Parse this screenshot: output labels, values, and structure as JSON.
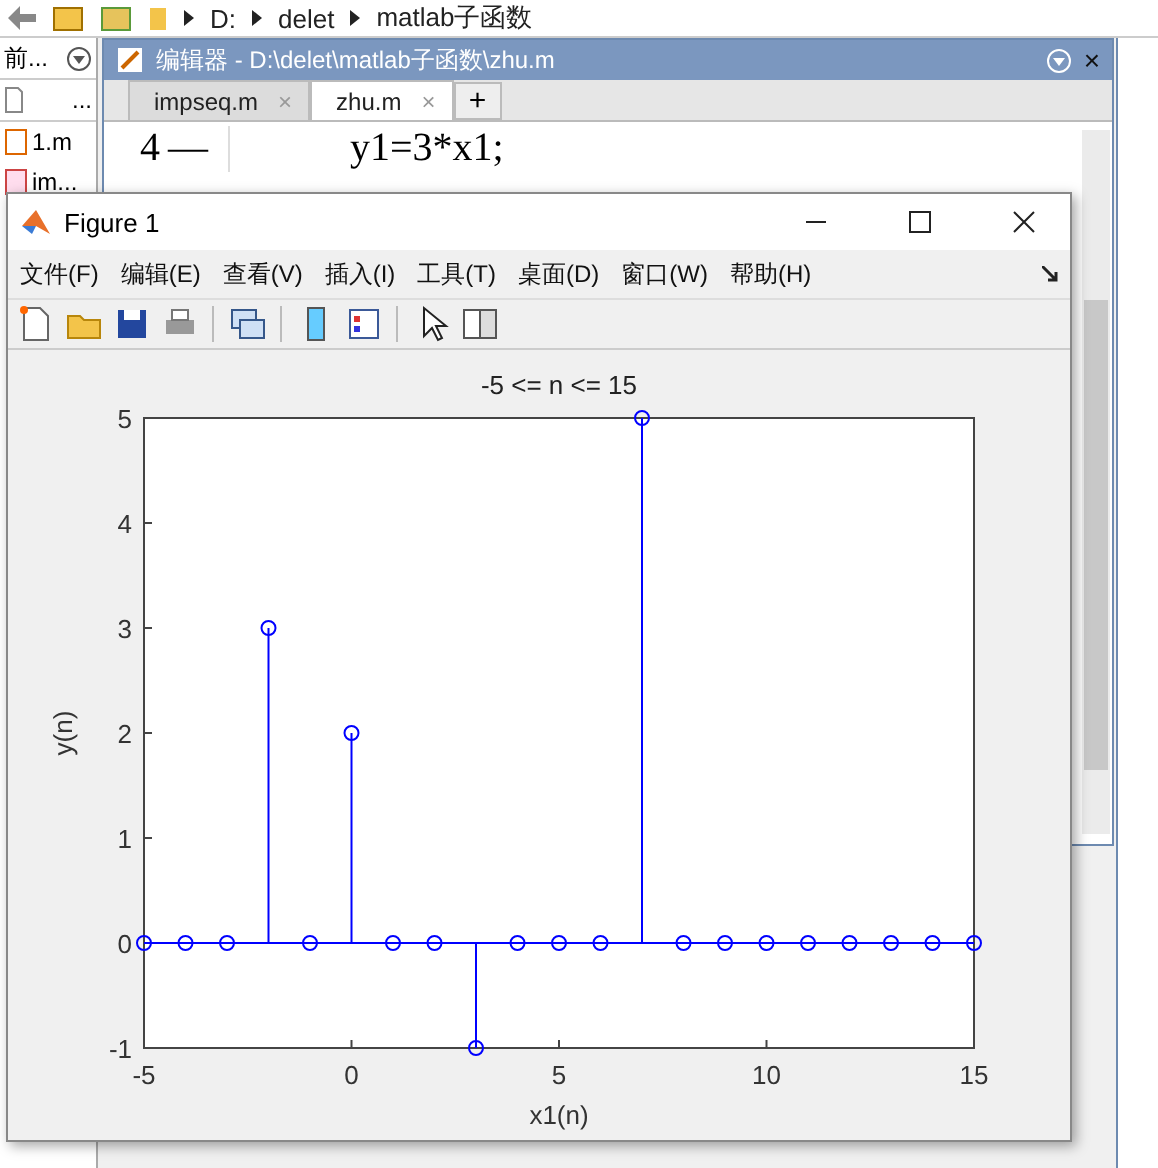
{
  "address_bar": {
    "segments": [
      "D:",
      "delet",
      "matlab子函数"
    ]
  },
  "file_panel": {
    "header": "前...",
    "column": "...",
    "files": [
      {
        "name": "1.m",
        "kind": "script"
      },
      {
        "name": "im...",
        "kind": "function"
      }
    ]
  },
  "editor": {
    "title": "编辑器 - D:\\delet\\matlab子函数\\zhu.m",
    "close": "×",
    "tabs": [
      {
        "label": "impseq.m",
        "close": "×",
        "selected": false
      },
      {
        "label": "zhu.m",
        "close": "×",
        "selected": true
      }
    ],
    "new_tab": "+",
    "line": {
      "number": "4",
      "marker": "—",
      "code": "y1=3*x1;"
    }
  },
  "figure": {
    "title": "Figure 1",
    "menu": [
      "文件(F)",
      "编辑(E)",
      "查看(V)",
      "插入(I)",
      "工具(T)",
      "桌面(D)",
      "窗口(W)",
      "帮助(H)"
    ],
    "chart_data": {
      "type": "bar",
      "title": "-5 <= n <= 15",
      "xlabel": "x1(n)",
      "ylabel": "y(n)",
      "x": [
        -5,
        -4,
        -3,
        -2,
        -1,
        0,
        1,
        2,
        3,
        4,
        5,
        6,
        7,
        8,
        9,
        10,
        11,
        12,
        13,
        14,
        15
      ],
      "series": [
        {
          "color": "#0000ff",
          "values": [
            0,
            0,
            0,
            3,
            0,
            2,
            0,
            0,
            -1,
            0,
            0,
            0,
            5,
            0,
            0,
            0,
            0,
            0,
            0,
            0,
            0
          ]
        }
      ],
      "ref_lines": [
        {
          "axis": "y",
          "value": 0,
          "color": "#0000ff"
        }
      ],
      "xlim": [
        -5,
        15
      ],
      "ylim": [
        -1,
        5
      ],
      "xticks": [
        -5,
        0,
        5,
        10,
        15
      ],
      "yticks": [
        -1,
        0,
        1,
        2,
        3,
        4,
        5
      ]
    }
  }
}
